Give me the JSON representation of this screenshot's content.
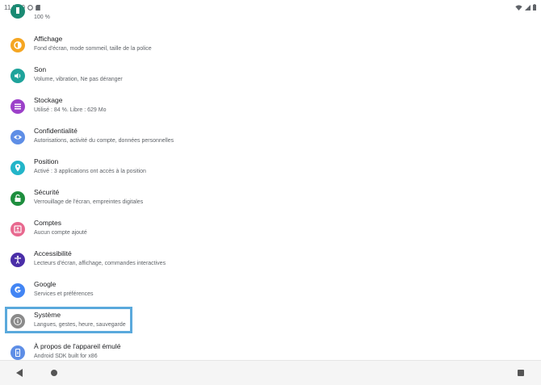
{
  "status_bar": {
    "time": "11 h 49"
  },
  "settings": {
    "partial_item": {
      "subtitle": "100 %",
      "color": "#1a8a73"
    },
    "items": [
      {
        "title": "Affichage",
        "subtitle": "Fond d'écran, mode sommeil, taille de la police",
        "color": "#f5a623",
        "icon": "brightness-icon"
      },
      {
        "title": "Son",
        "subtitle": "Volume, vibration, Ne pas déranger",
        "color": "#1fa39b",
        "icon": "volume-icon"
      },
      {
        "title": "Stockage",
        "subtitle": "Utilisé : 84 %. Libre : 629 Mo",
        "color": "#9c40c9",
        "icon": "storage-icon"
      },
      {
        "title": "Confidentialité",
        "subtitle": "Autorisations, activité du compte, données personnelles",
        "color": "#5e8ee6",
        "icon": "eye-icon"
      },
      {
        "title": "Position",
        "subtitle": "Activé : 3 applications ont accès à la position",
        "color": "#23b5c9",
        "icon": "location-icon"
      },
      {
        "title": "Sécurité",
        "subtitle": "Verrouillage de l'écran, empreintes digitales",
        "color": "#1e8e3e",
        "icon": "lock-icon"
      },
      {
        "title": "Comptes",
        "subtitle": "Aucun compte ajouté",
        "color": "#e8698f",
        "icon": "account-icon"
      },
      {
        "title": "Accessibilité",
        "subtitle": "Lecteurs d'écran, affichage, commandes interactives",
        "color": "#4a2ea8",
        "icon": "accessibility-icon"
      },
      {
        "title": "Google",
        "subtitle": "Services et préférences",
        "color": "#4285f4",
        "icon": "google-icon"
      },
      {
        "title": "Système",
        "subtitle": "Langues, gestes, heure, sauvegarde",
        "color": "#8a8a8a",
        "icon": "info-icon"
      },
      {
        "title": "À propos de l'appareil émulé",
        "subtitle": "Android SDK built for x86",
        "color": "#5e8ee6",
        "icon": "phone-icon"
      }
    ]
  },
  "highlight_color": "#5aa9dc"
}
